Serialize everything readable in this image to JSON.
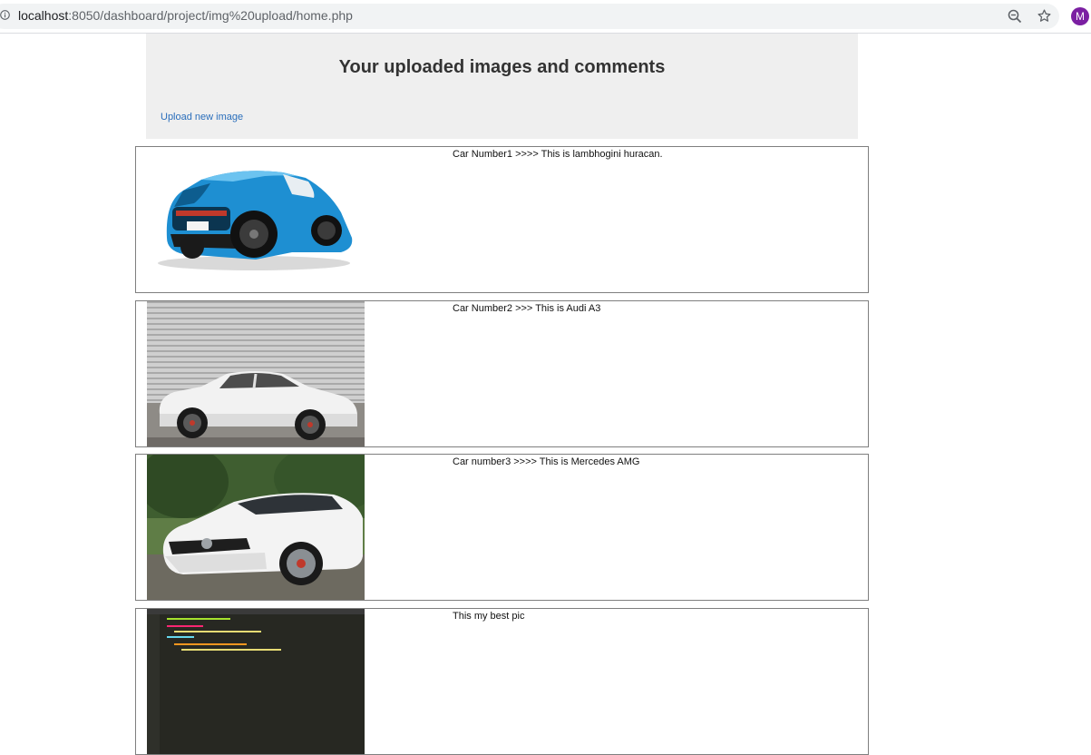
{
  "browser": {
    "url_host": "localhost",
    "url_rest": ":8050/dashboard/project/img%20upload/home.php",
    "avatar_letter": "M"
  },
  "header": {
    "title": "Your uploaded images and comments",
    "upload_link": "Upload new image"
  },
  "posts": [
    {
      "comment": "Car Number1 >>>> This is lambhogini huracan.",
      "image": "blue-sports-car"
    },
    {
      "comment": "Car Number2 >>> This is Audi A3",
      "image": "white-sedan-car"
    },
    {
      "comment": "Car number3 >>>> This is Mercedes AMG",
      "image": "white-coupe-car"
    },
    {
      "comment": "This my best pic",
      "image": "code-editor-screenshot"
    }
  ],
  "colors": {
    "link": "#2a6ebb",
    "header_bg": "#efefef",
    "avatar_bg": "#7b1fa2"
  }
}
